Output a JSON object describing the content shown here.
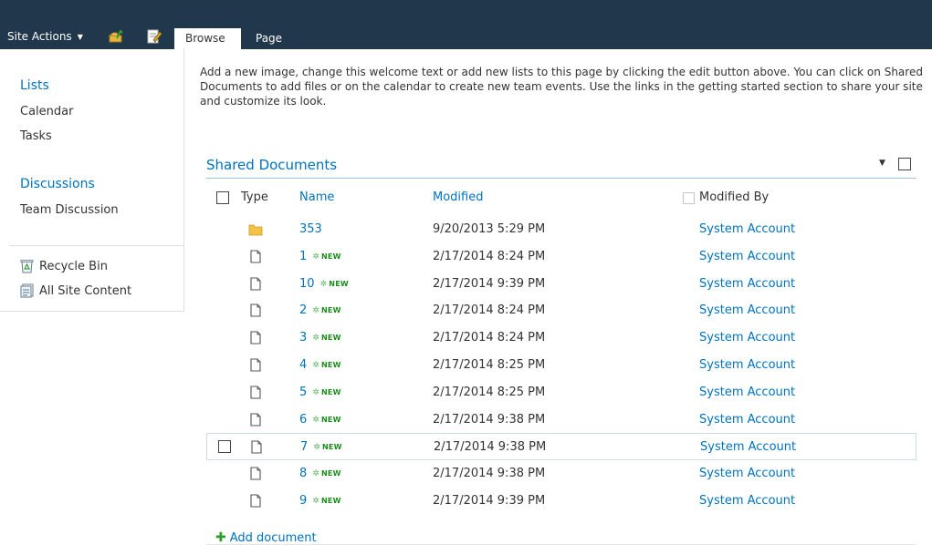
{
  "ribbon": {
    "site_actions_label": "Site Actions",
    "tabs": [
      {
        "label": "Browse",
        "active": true
      },
      {
        "label": "Page",
        "active": false
      }
    ]
  },
  "left_nav": {
    "lists_heading": "Lists",
    "lists": [
      "Calendar",
      "Tasks"
    ],
    "discussions_heading": "Discussions",
    "discussions": [
      "Team Discussion"
    ],
    "recycle_bin": "Recycle Bin",
    "all_site_content": "All Site Content"
  },
  "welcome_text": "Add a new image, change this welcome text or add new lists to this page by clicking the edit button above. You can click on Shared Documents to add files or on the calendar to create new team events. Use the links in the getting started section to share your site and customize its look.",
  "shared_documents": {
    "title": "Shared Documents",
    "menu_glyph": "▼",
    "columns": {
      "type": "Type",
      "name": "Name",
      "modified": "Modified",
      "modified_by": "Modified By"
    },
    "new_badge": "NEW",
    "rows": [
      {
        "type": "folder",
        "name": "353",
        "is_new": false,
        "modified": "9/20/2013 5:29 PM",
        "modified_by": "System Account",
        "selected": false
      },
      {
        "type": "file",
        "name": "1",
        "is_new": true,
        "modified": "2/17/2014 8:24 PM",
        "modified_by": "System Account",
        "selected": false
      },
      {
        "type": "file",
        "name": "10",
        "is_new": true,
        "modified": "2/17/2014 9:39 PM",
        "modified_by": "System Account",
        "selected": false
      },
      {
        "type": "file",
        "name": "2",
        "is_new": true,
        "modified": "2/17/2014 8:24 PM",
        "modified_by": "System Account",
        "selected": false
      },
      {
        "type": "file",
        "name": "3",
        "is_new": true,
        "modified": "2/17/2014 8:24 PM",
        "modified_by": "System Account",
        "selected": false
      },
      {
        "type": "file",
        "name": "4",
        "is_new": true,
        "modified": "2/17/2014 8:25 PM",
        "modified_by": "System Account",
        "selected": false
      },
      {
        "type": "file",
        "name": "5",
        "is_new": true,
        "modified": "2/17/2014 8:25 PM",
        "modified_by": "System Account",
        "selected": false
      },
      {
        "type": "file",
        "name": "6",
        "is_new": true,
        "modified": "2/17/2014 9:38 PM",
        "modified_by": "System Account",
        "selected": false
      },
      {
        "type": "file",
        "name": "7",
        "is_new": true,
        "modified": "2/17/2014 9:38 PM",
        "modified_by": "System Account",
        "selected": true
      },
      {
        "type": "file",
        "name": "8",
        "is_new": true,
        "modified": "2/17/2014 9:38 PM",
        "modified_by": "System Account",
        "selected": false
      },
      {
        "type": "file",
        "name": "9",
        "is_new": true,
        "modified": "2/17/2014 9:39 PM",
        "modified_by": "System Account",
        "selected": false
      }
    ],
    "add_document_label": "Add document"
  },
  "colors": {
    "ribbon_bg": "#21374c",
    "link": "#0072bc",
    "new_badge": "#1a8c1a",
    "folder": "#f5c343"
  }
}
